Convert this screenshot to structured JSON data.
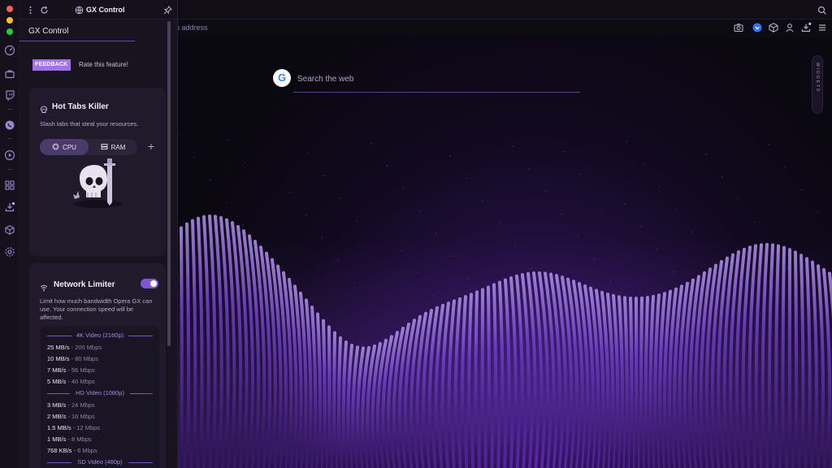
{
  "panel": {
    "title": "GX Control",
    "heading": "GX Control",
    "feedback_label": "FEEDBACK",
    "rate_text": "Rate this feature!"
  },
  "hot_tabs": {
    "title": "Hot Tabs Killer",
    "description": "Slash tabs that steal your resources.",
    "cpu_label": "CPU",
    "ram_label": "RAM",
    "add_label": "+"
  },
  "network": {
    "title": "Network Limiter",
    "enabled": true,
    "description": [
      "Limit how much bandwidth Opera GX can",
      "use. Your connection speed will be",
      "affected."
    ],
    "groups": [
      {
        "label": "4K Video (2160p)",
        "rows": [
          {
            "rate": "25 MB/s",
            "mbps": "200 Mbps"
          },
          {
            "rate": "10 MB/s",
            "mbps": "80 Mbps"
          },
          {
            "rate": "7 MB/s",
            "mbps": "56 Mbps"
          },
          {
            "rate": "5 MB/s",
            "mbps": "40 Mbps"
          }
        ]
      },
      {
        "label": "HD Video (1080p)",
        "rows": [
          {
            "rate": "3 MB/s",
            "mbps": "24 Mbps"
          },
          {
            "rate": "2 MB/s",
            "mbps": "16 Mbps"
          },
          {
            "rate": "1.5 MB/s",
            "mbps": "12 Mbps"
          },
          {
            "rate": "1 MB/s",
            "mbps": "8 Mbps"
          },
          {
            "rate": "768 KB/s",
            "mbps": "6 Mbps"
          }
        ]
      },
      {
        "label": "SD Video (480p)",
        "rows": []
      }
    ]
  },
  "address_bar": {
    "placeholder_fragment": "o address"
  },
  "search": {
    "placeholder": "Search the web",
    "logo_letter": "G"
  },
  "side_widget": {
    "text": "WIDGETS"
  },
  "colors": {
    "accent": "#a273e6",
    "background": "#0c0a12",
    "panel": "#17131f",
    "card": "#201a2b"
  },
  "icons": {
    "rail": [
      "speed-dial-icon",
      "briefcase-icon",
      "twitch-icon",
      "whatsapp-icon",
      "player-icon",
      "extensions-icon",
      "downloads-icon",
      "cube-icon",
      "settings-icon"
    ],
    "toolbar": [
      "camera-icon",
      "vpn-shield-icon",
      "box-icon",
      "profile-icon",
      "download-icon",
      "menu-icon"
    ]
  }
}
